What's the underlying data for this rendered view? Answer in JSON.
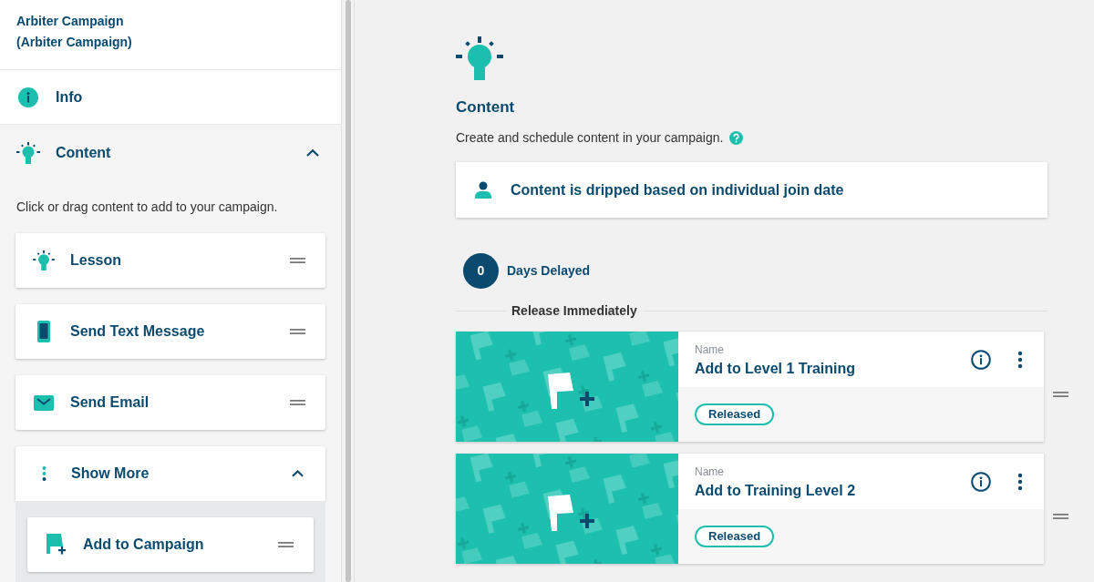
{
  "sidebar": {
    "title": "Arbiter Campaign (Arbiter Campaign)",
    "info_item": {
      "label": "Info"
    },
    "content_section": {
      "label": "Content",
      "expanded": true,
      "hint": "Click or drag content to add to your campaign.",
      "items": [
        {
          "kind": "lesson",
          "label": "Lesson"
        },
        {
          "kind": "text_message",
          "label": "Send Text Message"
        },
        {
          "kind": "email",
          "label": "Send Email"
        }
      ],
      "show_more": {
        "label": "Show More",
        "expanded": true,
        "items": [
          {
            "kind": "add_to_campaign",
            "label": "Add to Campaign"
          }
        ]
      }
    }
  },
  "main": {
    "heading": "Content",
    "description": "Create and schedule content in your campaign.",
    "drip_notice": "Content is dripped based on individual join date",
    "delay": {
      "days": "0",
      "label": "Days Delayed"
    },
    "release_label": "Release Immediately",
    "items": [
      {
        "name_label": "Name",
        "title": "Add to Level 1 Training",
        "status": "Released"
      },
      {
        "name_label": "Name",
        "title": "Add to Training Level 2",
        "status": "Released"
      }
    ]
  }
}
